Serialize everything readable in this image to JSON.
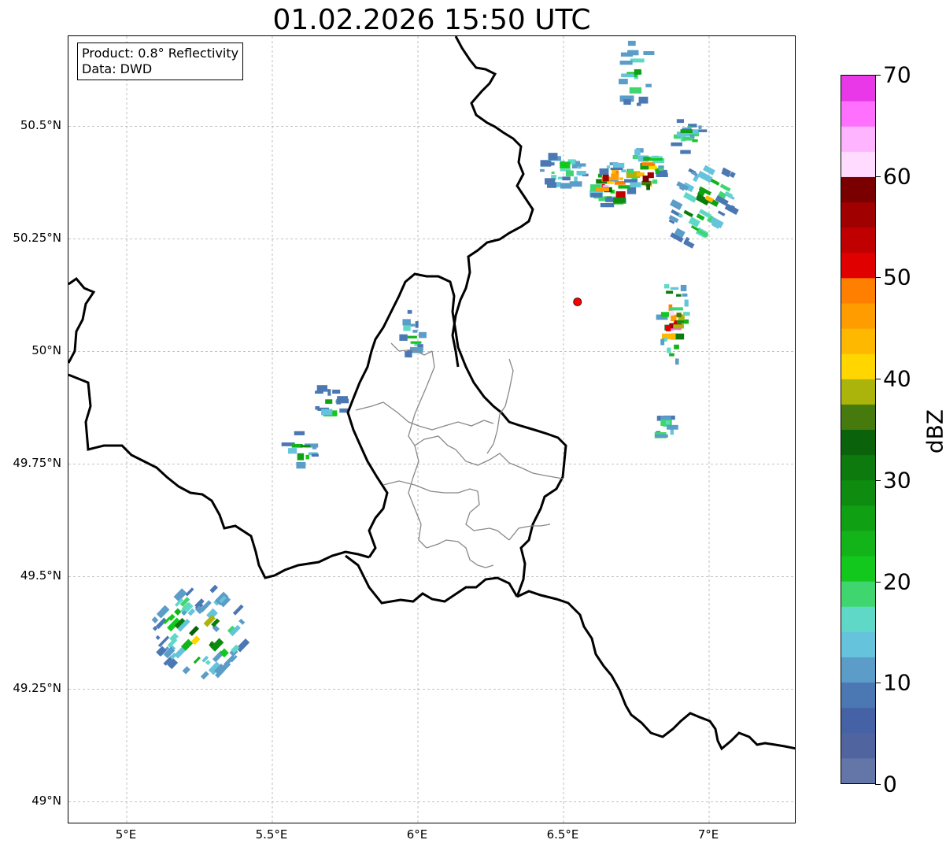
{
  "title": "01.02.2026 15:50 UTC",
  "info_box": {
    "product": "Product: 0.8° Reflectivity",
    "data": "Data: DWD"
  },
  "map": {
    "lon_range": [
      4.8,
      7.3
    ],
    "lat_range": [
      48.95,
      50.7
    ],
    "radar_site": {
      "lon": 6.548,
      "lat": 50.11,
      "color": "#ff0000"
    },
    "lat_ticks": [
      {
        "value": 49.0,
        "label": "49°N"
      },
      {
        "value": 49.25,
        "label": "49.25°N"
      },
      {
        "value": 49.5,
        "label": "49.5°N"
      },
      {
        "value": 49.75,
        "label": "49.75°N"
      },
      {
        "value": 50.0,
        "label": "50°N"
      },
      {
        "value": 50.25,
        "label": "50.25°N"
      },
      {
        "value": 50.5,
        "label": "50.5°N"
      }
    ],
    "lon_ticks": [
      {
        "value": 5.0,
        "label": "5°E"
      },
      {
        "value": 5.5,
        "label": "5.5°E"
      },
      {
        "value": 6.0,
        "label": "6°E"
      },
      {
        "value": 6.5,
        "label": "6.5°E"
      },
      {
        "value": 7.0,
        "label": "7°E"
      }
    ],
    "grid": true
  },
  "colorbar": {
    "label": "dBZ",
    "min": 0,
    "max": 70,
    "ticks": [
      {
        "value": 0,
        "label": "0"
      },
      {
        "value": 10,
        "label": "10"
      },
      {
        "value": 20,
        "label": "20"
      },
      {
        "value": 30,
        "label": "30"
      },
      {
        "value": 40,
        "label": "40"
      },
      {
        "value": 50,
        "label": "50"
      },
      {
        "value": 60,
        "label": "60"
      },
      {
        "value": 70,
        "label": "70"
      }
    ],
    "colors": [
      "#6475a8",
      "#5065a0",
      "#4562a6",
      "#4b78b2",
      "#5b9cc8",
      "#65c3dc",
      "#60d8c8",
      "#3fd670",
      "#12c81c",
      "#12b41a",
      "#10a014",
      "#0e8c10",
      "#0c7a0c",
      "#0a620a",
      "#467a0c",
      "#aab40a",
      "#ffd600",
      "#ffb800",
      "#ff9c00",
      "#ff8000",
      "#e00000",
      "#c00000",
      "#a00000",
      "#7a0000",
      "#ffdcff",
      "#ffb4ff",
      "#ff70ff",
      "#e838e8"
    ]
  },
  "echoes": [
    {
      "name": "southwest-cluster",
      "lon": 5.25,
      "lat": 49.38,
      "rx": 0.15,
      "ry": 0.11,
      "angle": -0.8,
      "level": 12,
      "count": 70
    },
    {
      "name": "north-cluster-a",
      "lon": 6.67,
      "lat": 50.37,
      "rx": 0.07,
      "ry": 0.05,
      "angle": 0,
      "level": 24,
      "count": 40
    },
    {
      "name": "north-cluster-b",
      "lon": 6.78,
      "lat": 50.4,
      "rx": 0.06,
      "ry": 0.05,
      "angle": 0,
      "level": 22,
      "count": 35
    },
    {
      "name": "north-cluster-c",
      "lon": 6.5,
      "lat": 50.4,
      "rx": 0.08,
      "ry": 0.04,
      "angle": 0,
      "level": 8,
      "count": 30
    },
    {
      "name": "northeast-cluster",
      "lon": 6.98,
      "lat": 50.33,
      "rx": 0.1,
      "ry": 0.1,
      "angle": 0.5,
      "level": 12,
      "count": 45
    },
    {
      "name": "northeast-top",
      "lon": 6.93,
      "lat": 50.48,
      "rx": 0.05,
      "ry": 0.04,
      "angle": 0,
      "level": 8,
      "count": 18
    },
    {
      "name": "east-cells",
      "lon": 6.88,
      "lat": 50.07,
      "rx": 0.05,
      "ry": 0.1,
      "angle": 0,
      "level": 18,
      "count": 35
    },
    {
      "name": "east-south",
      "lon": 6.85,
      "lat": 49.82,
      "rx": 0.03,
      "ry": 0.04,
      "angle": 0,
      "level": 8,
      "count": 12
    },
    {
      "name": "top-edge",
      "lon": 6.75,
      "lat": 50.62,
      "rx": 0.06,
      "ry": 0.08,
      "angle": 0,
      "level": 8,
      "count": 18
    },
    {
      "name": "center-north",
      "lon": 5.98,
      "lat": 50.04,
      "rx": 0.04,
      "ry": 0.05,
      "angle": 0,
      "level": 8,
      "count": 18
    },
    {
      "name": "center-west",
      "lon": 5.7,
      "lat": 49.88,
      "rx": 0.05,
      "ry": 0.05,
      "angle": 0,
      "level": 8,
      "count": 16
    },
    {
      "name": "west-small",
      "lon": 5.6,
      "lat": 49.78,
      "rx": 0.05,
      "ry": 0.04,
      "angle": 0,
      "level": 10,
      "count": 12
    }
  ]
}
